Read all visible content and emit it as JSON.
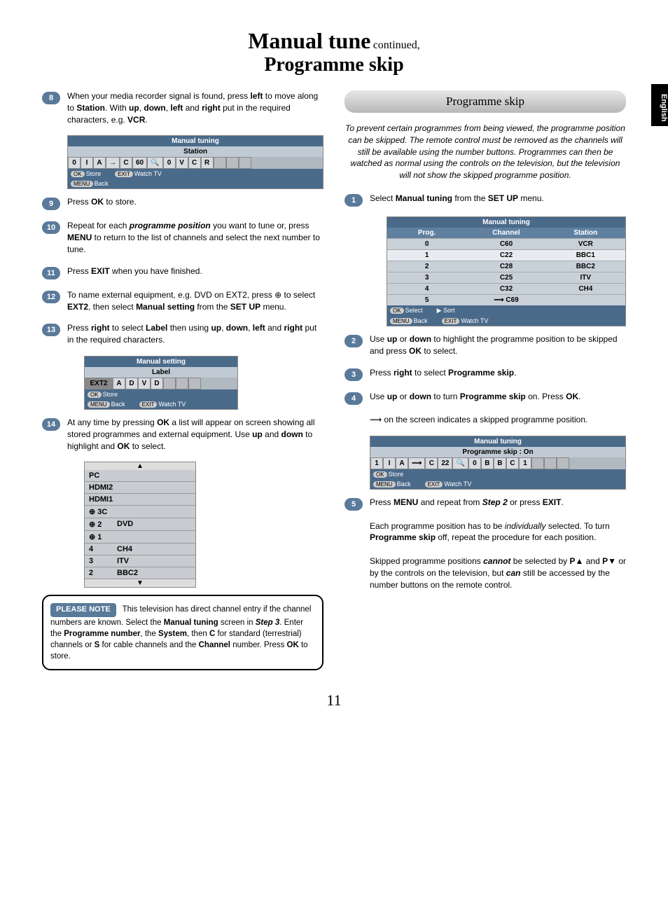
{
  "page_number": "11",
  "side_tab": "English",
  "title": {
    "main": "Manual tune",
    "cont": "continued,",
    "sub": "Programme skip"
  },
  "left": {
    "steps": {
      "8": "When your media recorder signal is found, press <b>left</b> to move along to <b>Station</b>. With <b>up</b>, <b>down</b>, <b>left</b> and <b>right</b> put in the required characters, e.g. <b>VCR</b>.",
      "9": "Press <b>OK</b> to store.",
      "10": "Repeat for each <b><i>programme position</i></b> you want to tune or, press <b>MENU</b> to return to the list of channels and select the next number to tune.",
      "11": "Press <b>EXIT</b> when you have finished.",
      "12": "To name external equipment, e.g. DVD on EXT2, press ⊕ to select <b>EXT2</b>, then select <b>Manual setting</b> from the <b>SET UP</b> menu.",
      "13": "Press <b>right</b> to select <b>Label</b> then using <b>up</b>, <b>down</b>, <b>left</b> and <b>right</b> put in the required characters.",
      "14": "At any time by pressing <b>OK</b> a list will appear on screen showing all stored programmes and external equipment. Use <b>up</b> and <b>down</b> to highlight and <b>OK</b> to select."
    },
    "osd1": {
      "title": "Manual tuning",
      "sub": "Station",
      "cells": [
        "0",
        "I",
        "A",
        "→",
        "C",
        "60",
        "🔍",
        "0",
        "V",
        "C",
        "R",
        "",
        "",
        ""
      ],
      "footer": {
        "ok": "OK",
        "store": "Store",
        "menu": "MENU",
        "back": "Back",
        "exit": "EXIT",
        "watch": "Watch TV"
      }
    },
    "osd2": {
      "title": "Manual setting",
      "sub": "Label",
      "ext": "EXT2",
      "cells": [
        "A",
        "D",
        "V",
        "D",
        "",
        "",
        ""
      ],
      "footer": {
        "ok": "OK",
        "store": "Store",
        "menu": "MENU",
        "back": "Back",
        "exit": "EXIT",
        "watch": "Watch TV"
      }
    },
    "list": [
      {
        "c1": "PC",
        "c2": ""
      },
      {
        "c1": "HDMI2",
        "c2": ""
      },
      {
        "c1": "HDMI1",
        "c2": ""
      },
      {
        "c1": "⊕ 3C",
        "c2": ""
      },
      {
        "c1": "⊕ 2",
        "c2": "DVD"
      },
      {
        "c1": "⊕ 1",
        "c2": ""
      },
      {
        "c1": "4",
        "c2": "CH4"
      },
      {
        "c1": "3",
        "c2": "ITV"
      },
      {
        "c1": "2",
        "c2": "BBC2"
      }
    ],
    "note": {
      "badge": "PLEASE NOTE",
      "text": "This television has direct channel entry if the channel numbers are known. Select the <b>Manual tuning</b> screen in <b><i>Step 3</i></b>. Enter the <b>Programme number</b>, the <b>System</b>, then <b>C</b> for standard (terrestrial) channels or <b>S</b> for cable channels and the <b>Channel</b> number. Press <b>OK</b> to store."
    }
  },
  "right": {
    "header": "Programme skip",
    "intro": "To prevent certain programmes from being viewed, the programme position can be skipped. The remote control must be removed as the channels will still be available using the number buttons. Programmes can then be watched as normal using the controls on the television, but the television will not show the skipped programme position.",
    "steps": {
      "1": "Select <b>Manual tuning</b> from the <b>SET UP</b> menu.",
      "2": "Use <b>up</b> or <b>down</b> to highlight the programme position to be skipped and press <b>OK</b> to select.",
      "3": "Press <b>right</b> to select <b>Programme skip</b>.",
      "4": "Use <b>up</b> or <b>down</b> to turn <b>Programme skip</b> on. Press <b>OK</b>.",
      "4b": "⟿ on the screen indicates a skipped programme position.",
      "5": "Press <b>MENU</b> and repeat from <b><i>Step 2</i></b> or press <b>EXIT</b>.",
      "5b": "Each programme position has to be <i>individually</i> selected. To turn <b>Programme skip</b> off, repeat the procedure for each position.",
      "5c": "Skipped programme positions <b><i>cannot</i></b> be selected by <b>P▲</b> and <b>P▼</b> or by the controls on the television, but <b><i>can</i></b> still be accessed by the number buttons on the remote control."
    },
    "prog_table": {
      "title": "Manual tuning",
      "cols": [
        "Prog.",
        "Channel",
        "Station"
      ],
      "rows": [
        {
          "p": "0",
          "c": "C60",
          "s": "VCR"
        },
        {
          "p": "1",
          "c": "C22",
          "s": "BBC1"
        },
        {
          "p": "2",
          "c": "C28",
          "s": "BBC2"
        },
        {
          "p": "3",
          "c": "C25",
          "s": "ITV"
        },
        {
          "p": "4",
          "c": "C32",
          "s": "CH4"
        },
        {
          "p": "5",
          "c": "⟿ C69",
          "s": ""
        }
      ],
      "footer": {
        "ok": "OK",
        "select": "Select",
        "menu": "MENU",
        "back": "Back",
        "sort": "Sort",
        "exit": "EXIT",
        "watch": "Watch TV"
      }
    },
    "osd3": {
      "title": "Manual tuning",
      "sub": "Programme skip : On",
      "cells": [
        "1",
        "I",
        "A",
        "⟿",
        "C",
        "22",
        "🔍",
        "0",
        "B",
        "B",
        "C",
        "1",
        "",
        "",
        ""
      ],
      "footer": {
        "ok": "OK",
        "store": "Store",
        "menu": "MENU",
        "back": "Back",
        "exit": "EXIT",
        "watch": "Watch TV"
      }
    }
  }
}
